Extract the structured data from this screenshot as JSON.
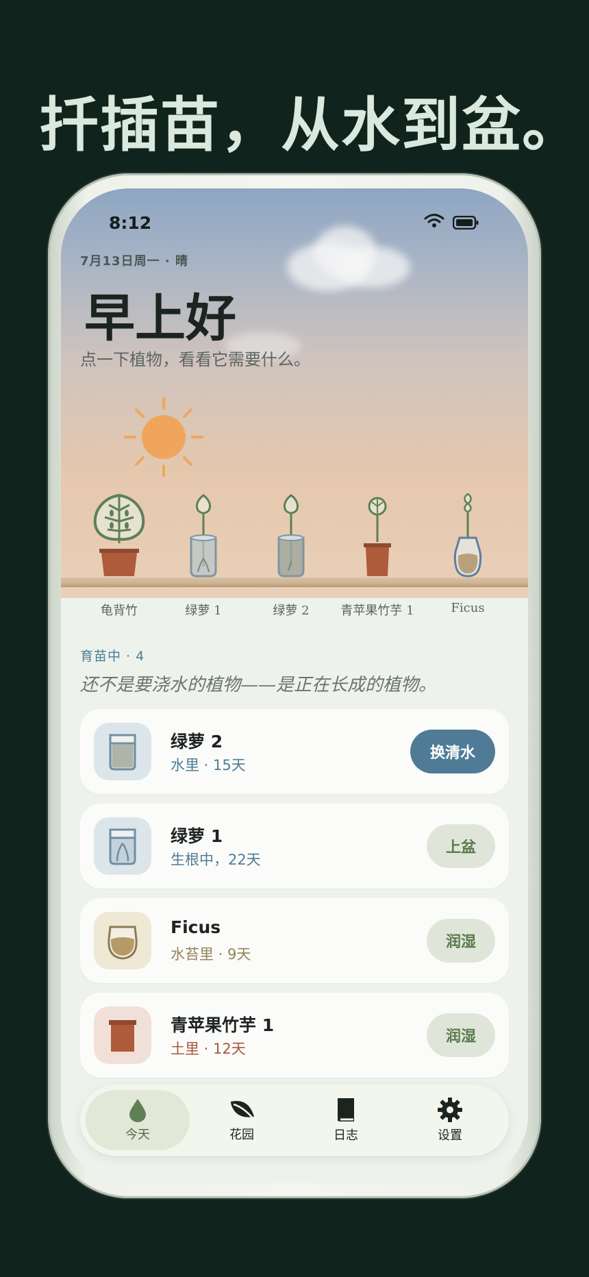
{
  "headline": "扦插苗，从水到盆。",
  "status_bar": {
    "time": "8:12"
  },
  "header": {
    "date_weather": "7月13日周一 · 晴",
    "greeting": "早上好",
    "subtitle": "点一下植物，看看它需要什么。"
  },
  "shelf_plants": [
    {
      "label": "龟背竹",
      "icon": "monstera-pot-icon"
    },
    {
      "label": "绿萝 1",
      "icon": "pothos-water-jar-icon"
    },
    {
      "label": "绿萝 2",
      "icon": "pothos-water-jar-icon"
    },
    {
      "label": "青苹果竹芋 1",
      "icon": "calathea-pot-icon"
    },
    {
      "label": "Ficus",
      "icon": "ficus-moss-jar-icon"
    }
  ],
  "section": {
    "title": "育苗中 · 4",
    "tagline": "还不是要浇水的植物——是正在长成的植物。"
  },
  "cards": [
    {
      "name": "绿萝 2",
      "status": "水里 · 15天",
      "status_color": "#4f7b96",
      "thumb_bg": "#dce6ea",
      "thumb_icon": "water-jar-icon",
      "action": "换清水",
      "action_primary": true
    },
    {
      "name": "绿萝 1",
      "status": "生根中，22天",
      "status_color": "#4f7b96",
      "thumb_bg": "#dce6ea",
      "thumb_icon": "rooting-jar-icon",
      "action": "上盆",
      "action_primary": false
    },
    {
      "name": "Ficus",
      "status": "水苔里 · 9天",
      "status_color": "#93825b",
      "thumb_bg": "#efe8d5",
      "thumb_icon": "moss-jar-icon",
      "action": "润湿",
      "action_primary": false
    },
    {
      "name": "青苹果竹芋 1",
      "status": "土里 · 12天",
      "status_color": "#a6573a",
      "thumb_bg": "#f1e0d8",
      "thumb_icon": "soil-pot-icon",
      "action": "润湿",
      "action_primary": false
    }
  ],
  "tabbar": {
    "items": [
      {
        "label": "今天",
        "icon": "water-drop-icon",
        "active": true
      },
      {
        "label": "花园",
        "icon": "leaf-icon",
        "active": false
      },
      {
        "label": "日志",
        "icon": "book-icon",
        "active": false
      },
      {
        "label": "设置",
        "icon": "gear-icon",
        "active": false
      }
    ]
  },
  "colors": {
    "background": "#10231d",
    "primary_button": "#4f7b96",
    "secondary_button": "#dfe6d9",
    "secondary_button_text": "#5b7a4d",
    "pot": "#ad5b3b",
    "plant_stroke": "#5f7f56"
  }
}
